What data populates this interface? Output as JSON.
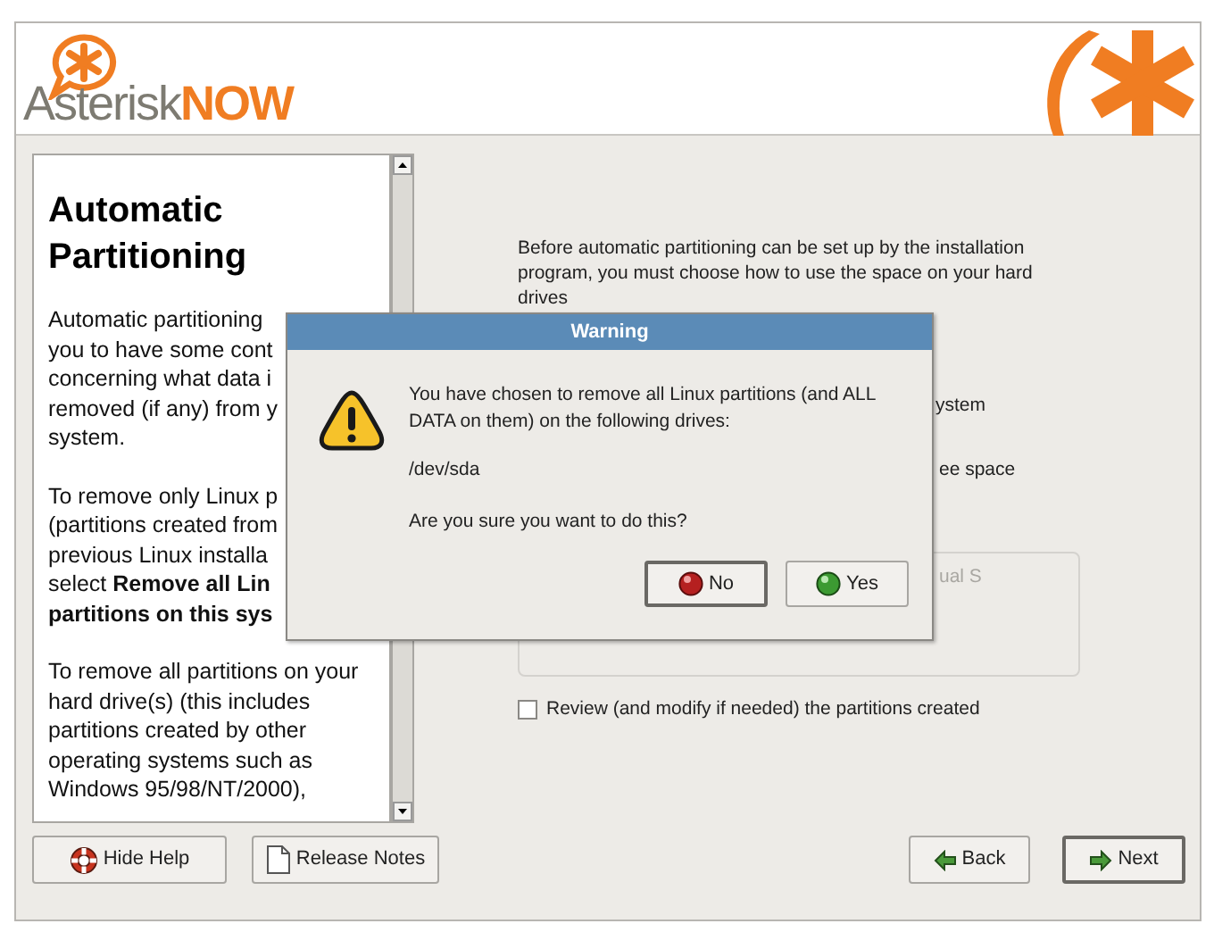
{
  "header": {
    "logo_word": "Asterisk",
    "logo_word_bold": "NOW"
  },
  "help": {
    "title": "Automatic Partitioning",
    "paragraphs": [
      [
        "Automatic partitioning",
        "you to have some cont",
        "concerning what data i",
        "removed (if any) from y",
        "system."
      ],
      [
        "To remove only Linux p",
        "(partitions created from",
        "previous Linux installa",
        "select **Remove all Lin**",
        "**partitions on this sys**"
      ],
      [
        "To remove all partitions on your",
        "hard drive(s) (this includes",
        "partitions created by other",
        "operating systems such as",
        "Windows 95/98/NT/2000),"
      ]
    ]
  },
  "main": {
    "intro_lines": [
      "Before automatic partitioning can be set up by the installation",
      "program, you must choose how to use the space on your hard",
      "drives"
    ],
    "option_fragments": [
      "ystem",
      "ee space"
    ],
    "disabled_box_fragment": "ual S",
    "review_checkbox": {
      "label": "Review (and modify if needed) the partitions created",
      "checked": false
    }
  },
  "dialog": {
    "title": "Warning",
    "message_lines": [
      "You have chosen to remove all Linux partitions (and ALL",
      "DATA on them) on the following drives:"
    ],
    "drive": "/dev/sda",
    "question": "Are you sure you want to do this?",
    "buttons": [
      {
        "label": "No",
        "kind": "no",
        "default": true
      },
      {
        "label": "Yes",
        "kind": "yes",
        "default": false
      }
    ]
  },
  "footer": {
    "left_buttons": [
      {
        "label": "Hide Help",
        "kind": "help"
      },
      {
        "label": "Release Notes",
        "kind": "notes"
      }
    ],
    "right_buttons": [
      {
        "label": "Back",
        "kind": "back",
        "default": false
      },
      {
        "label": "Next",
        "kind": "next",
        "default": true
      }
    ]
  }
}
